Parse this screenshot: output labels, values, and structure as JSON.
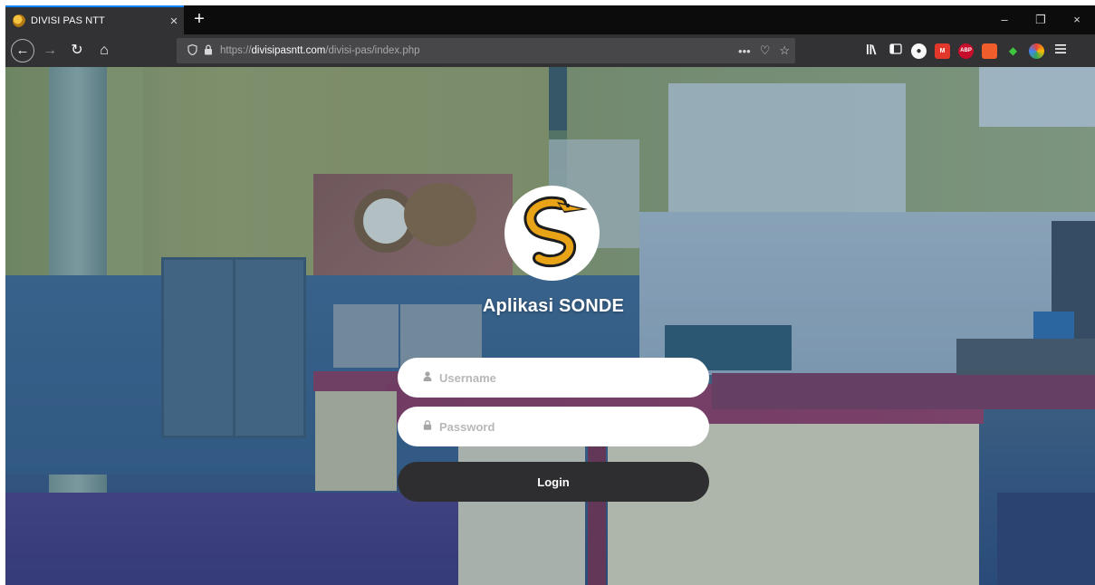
{
  "browser": {
    "tab": {
      "title": "DIVISI PAS NTT",
      "close": "×"
    },
    "new_tab": "+",
    "window_controls": {
      "minimize": "–",
      "restore": "❐",
      "close": "×"
    },
    "nav": {
      "back": "←",
      "forward": "→",
      "reload": "↻",
      "home": "⌂"
    },
    "url": {
      "scheme": "https://",
      "host": "divisipasntt.com",
      "path": "/divisi-pas/index.php"
    },
    "url_actions": {
      "more": "•••",
      "pocket": "♡",
      "bookmark": "☆"
    },
    "toolbar_icons": [
      "library-icon",
      "sidebar-icon",
      "account-icon",
      "extension-red-icon",
      "adblock-icon",
      "extension-orange-icon",
      "extension-green-icon",
      "extension-color-icon",
      "menu-icon"
    ]
  },
  "login": {
    "app_title": "Aplikasi SONDE",
    "username_placeholder": "Username",
    "password_placeholder": "Password",
    "login_label": "Login"
  },
  "colors": {
    "login_button": "#2e2e30",
    "overlay": "#28508c",
    "logo_orange": "#e8a317"
  }
}
